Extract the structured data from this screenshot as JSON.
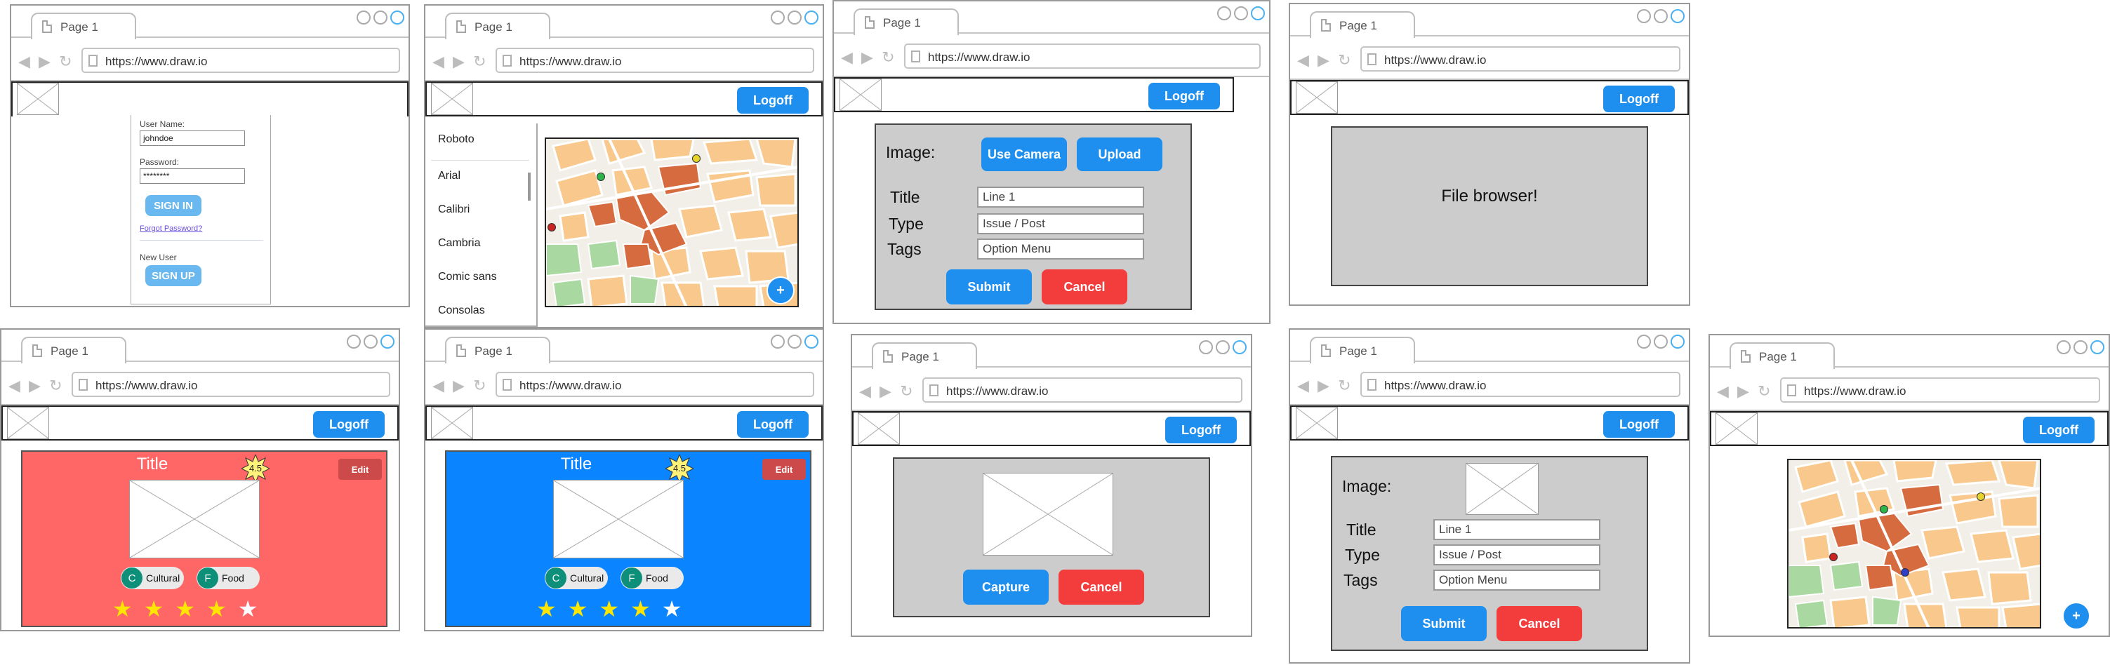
{
  "browser": {
    "tab_label": "Page 1",
    "url": "https://www.draw.io",
    "nav_arrows": "◀ ▶ ↻",
    "icons": {
      "nav": "back-forward-reload-icon",
      "page": "document-icon"
    }
  },
  "login": {
    "username_label": "User Name:",
    "username_value": "johndoe",
    "password_label": "Password:",
    "password_value": "********",
    "signin": "SIGN IN",
    "forgot": "Forgot Password?",
    "new_user": "New User",
    "signup": "SIGN UP"
  },
  "logoff": "Logoff",
  "fonts": [
    "Roboto",
    "Arial",
    "Calibri",
    "Cambria",
    "Comic sans",
    "Consolas"
  ],
  "fab": "+",
  "post_form": {
    "image_label": "Image:",
    "use_camera": "Use Camera",
    "upload": "Upload",
    "title_label": "Title",
    "title_value": "Line 1",
    "type_label": "Type",
    "type_value": "Issue / Post",
    "tags_label": "Tags",
    "tags_value": "Option Menu",
    "submit": "Submit",
    "cancel": "Cancel"
  },
  "file_browser": "File browser!",
  "camera": {
    "capture": "Capture",
    "cancel": "Cancel"
  },
  "cards": [
    {
      "title": "Title",
      "rating": "4.5",
      "edit": "Edit",
      "color": "#ff6666",
      "chips": [
        {
          "letter": "C",
          "label": "Cultural"
        },
        {
          "letter": "F",
          "label": "Food"
        }
      ],
      "stars": [
        "★",
        "★",
        "★",
        "★",
        "★"
      ],
      "rating_stars_filled": 4
    },
    {
      "title": "Title",
      "rating": "4.5",
      "edit": "Edit",
      "color": "#0a84ff",
      "chips": [
        {
          "letter": "C",
          "label": "Cultural"
        },
        {
          "letter": "F",
          "label": "Food"
        }
      ],
      "stars": [
        "★",
        "★",
        "★",
        "★",
        "★"
      ],
      "rating_stars_filled": 4
    }
  ],
  "colors": {
    "accent": "#1f8fef",
    "danger": "#f33c3c",
    "star": "#ffe600"
  }
}
